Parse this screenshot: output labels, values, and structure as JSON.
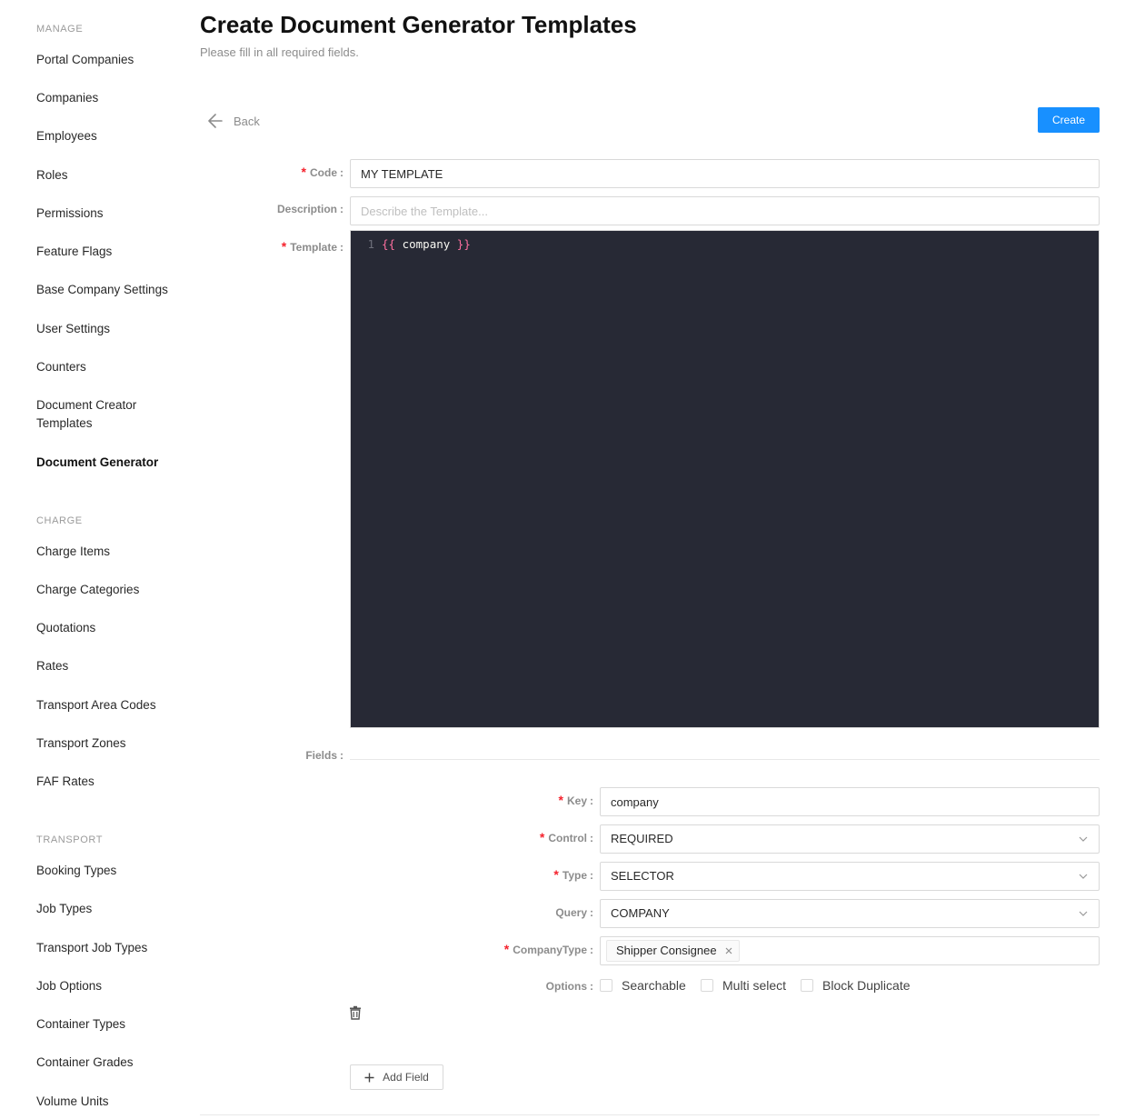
{
  "sidebar": {
    "sections": [
      {
        "title": "MANAGE",
        "items": [
          {
            "label": "Portal Companies"
          },
          {
            "label": "Companies"
          },
          {
            "label": "Employees"
          },
          {
            "label": "Roles"
          },
          {
            "label": "Permissions"
          },
          {
            "label": "Feature Flags"
          },
          {
            "label": "Base Company Settings"
          },
          {
            "label": "User Settings"
          },
          {
            "label": "Counters"
          },
          {
            "label": "Document Creator Templates"
          },
          {
            "label": "Document Generator",
            "active": true
          }
        ]
      },
      {
        "title": "CHARGE",
        "items": [
          {
            "label": "Charge Items"
          },
          {
            "label": "Charge Categories"
          },
          {
            "label": "Quotations"
          },
          {
            "label": "Rates"
          },
          {
            "label": "Transport Area Codes"
          },
          {
            "label": "Transport Zones"
          },
          {
            "label": "FAF Rates"
          }
        ]
      },
      {
        "title": "TRANSPORT",
        "items": [
          {
            "label": "Booking Types"
          },
          {
            "label": "Job Types"
          },
          {
            "label": "Transport Job Types"
          },
          {
            "label": "Job Options"
          },
          {
            "label": "Container Types"
          },
          {
            "label": "Container Grades"
          },
          {
            "label": "Volume Units"
          }
        ]
      }
    ]
  },
  "header": {
    "title": "Create Document Generator Templates",
    "subtitle": "Please fill in all required fields."
  },
  "toolbar": {
    "back_label": "Back",
    "create_label": "Create"
  },
  "form": {
    "code": {
      "label": "Code",
      "value": "MY TEMPLATE"
    },
    "description": {
      "label": "Description",
      "placeholder": "Describe the Template..."
    },
    "template": {
      "label": "Template",
      "line_number": "1",
      "open_brace": "{{",
      "code": " company ",
      "close_brace": "}}"
    },
    "fields_label": "Fields"
  },
  "field": {
    "key": {
      "label": "Key",
      "value": "company"
    },
    "control": {
      "label": "Control",
      "value": "REQUIRED"
    },
    "type": {
      "label": "Type",
      "value": "SELECTOR"
    },
    "query": {
      "label": "Query",
      "value": "COMPANY"
    },
    "company_type": {
      "label": "CompanyType",
      "tags": [
        "Shipper Consignee"
      ]
    },
    "options": {
      "label": "Options",
      "items": [
        {
          "label": "Searchable",
          "checked": false
        },
        {
          "label": "Multi select",
          "checked": false
        },
        {
          "label": "Block Duplicate",
          "checked": false
        }
      ]
    }
  },
  "add_field_label": "Add Field",
  "colors": {
    "primary": "#1890ff",
    "required": "#f5222d",
    "editor_bg": "#272935"
  }
}
